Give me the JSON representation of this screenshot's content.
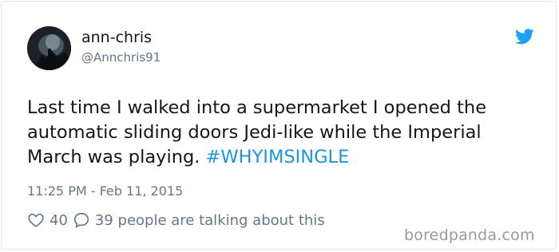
{
  "user": {
    "display_name": "ann-chris",
    "handle": "@Annchris91",
    "avatar_icon": "avatar-photo"
  },
  "tweet": {
    "text": "Last time I walked into a supermarket I opened the automatic sliding doors Jedi-like while the Imperial March was playing.",
    "hashtag": "#WHYIMSINGLE",
    "timestamp": "11:25 PM - Feb 11, 2015"
  },
  "stats": {
    "likes": "40",
    "replies_text": "39 people are talking about this"
  },
  "icons": {
    "brand": "twitter-bird-icon",
    "like": "heart-icon",
    "reply": "speech-bubble-icon"
  },
  "colors": {
    "brand_blue": "#1da1f2",
    "hashtag_blue": "#1b95e0",
    "muted_text": "#657786"
  },
  "watermark": "boredpanda.com"
}
